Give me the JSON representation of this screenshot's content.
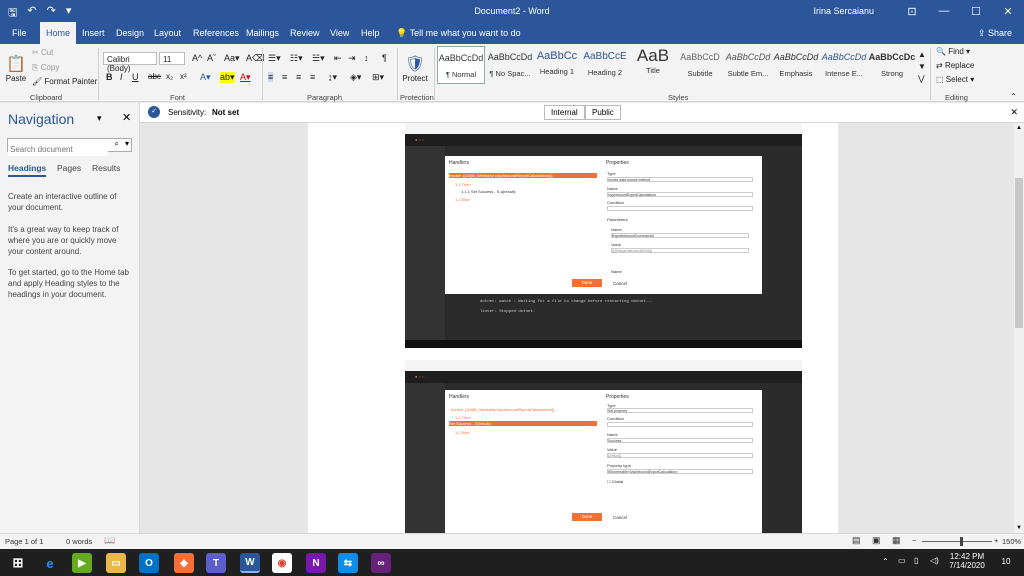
{
  "window": {
    "title": "Document2 - Word",
    "user": "Irina Sercaianu"
  },
  "tabs": [
    "File",
    "Home",
    "Insert",
    "Design",
    "Layout",
    "References",
    "Mailings",
    "Review",
    "View",
    "Help"
  ],
  "tell_me": "Tell me what you want to do",
  "share": "Share",
  "clipboard": {
    "paste": "Paste",
    "cut": "Cut",
    "copy": "Copy",
    "format_painter": "Format Painter",
    "label": "Clipboard"
  },
  "font": {
    "name": "Calibri (Body)",
    "size": "11",
    "label": "Font"
  },
  "paragraph": {
    "label": "Paragraph"
  },
  "protection": {
    "protect": "Protect",
    "label": "Protection"
  },
  "styles": {
    "label": "Styles",
    "items": [
      {
        "preview": "AaBbCcDd",
        "name": "¶ Normal"
      },
      {
        "preview": "AaBbCcDd",
        "name": "¶ No Spac..."
      },
      {
        "preview": "AaBbCc",
        "name": "Heading 1"
      },
      {
        "preview": "AaBbCcE",
        "name": "Heading 2"
      },
      {
        "preview": "AaB",
        "name": "Title"
      },
      {
        "preview": "AaBbCcD",
        "name": "Subtitle"
      },
      {
        "preview": "AaBbCcDd",
        "name": "Subtle Em..."
      },
      {
        "preview": "AaBbCcDd",
        "name": "Emphasis"
      },
      {
        "preview": "AaBbCcDd",
        "name": "Intense E..."
      },
      {
        "preview": "AaBbCcDc",
        "name": "Strong"
      }
    ]
  },
  "editing": {
    "find": "Find",
    "replace": "Replace",
    "select": "Select",
    "label": "Editing"
  },
  "sensitivity": {
    "label": "Sensitivity:",
    "value": "Not set",
    "internal": "Internal",
    "public": "Public"
  },
  "navigation": {
    "title": "Navigation",
    "search_placeholder": "Search document",
    "tabs": [
      "Headings",
      "Pages",
      "Results"
    ],
    "help1": "Create an interactive outline of your document.",
    "help2": "It's a great way to keep track of where you are or quickly move your content around.",
    "help3": "To get started, go to the Home tab and apply Heading styles to the headings in your document."
  },
  "shot1": {
    "handlers": "Handlers",
    "properties": "Properties",
    "type_label": "Type",
    "type_value": "Invoke data source method",
    "name_label": "Name",
    "name_value": "UspInboundExportCalculations",
    "condition": "Condition",
    "parameters": "Parameters",
    "p_name": "Name",
    "p_name_value": "ExportInboundCommandId",
    "p_value": "Value",
    "p_value_value": "{{@dependencies@field}}",
    "step_row": "Invoke: {{Ui@t_Weekday:UspInboundReportCalculations}}",
    "then": "1.1 Then",
    "sub": "1.1.1 Set Success - S.a(result);",
    "else": "1.2 Else",
    "done": "Done",
    "cancel": "Cancel",
    "console1": "dotnet: watch : Waiting for a file to change before restarting dotnet...",
    "console2": "linker: Stopped dotnet."
  },
  "shot2": {
    "handlers": "Handlers",
    "properties": "Properties",
    "type_label": "Type",
    "type_value": "Set property",
    "condition": "Condition",
    "name_label": "Name",
    "name_value": "Success",
    "value_label": "Value",
    "value_value": "{{result}}",
    "prop_type": "Property type",
    "prop_type_value": "IEnumerable<UspInboundExportCalculation>",
    "global": "Global",
    "row1": "Invoke: {{Ui@t_Weekday:UspInboundReportCalculations}}",
    "then": "1.1 Then",
    "sub": "Set Success - S(result);",
    "else": "1.2 Else",
    "done": "Done",
    "cancel": "Cancel"
  },
  "status": {
    "page": "Page 1 of 1",
    "words": "0 words",
    "zoom": "150%"
  },
  "taskbar": {
    "time": "12:42 PM",
    "date": "7/14/2020",
    "notif": "10"
  }
}
